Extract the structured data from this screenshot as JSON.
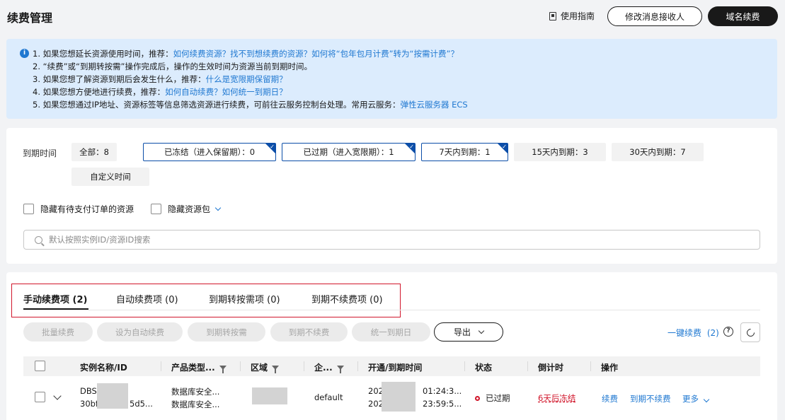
{
  "header": {
    "title": "续费管理",
    "guide": "使用指南",
    "modify_recipient": "修改消息接收人",
    "domain_renew": "域名续费"
  },
  "notice": {
    "icon": "info-icon",
    "lines": [
      {
        "text": "1. 如果您想延长资源使用时间，推荐：",
        "link": "如何续费资源？找不到想续费的资源？如何将“包年包月计费”转为“按需计费”？"
      },
      {
        "text": "2. “续费”或“到期转按需”操作完成后，操作的生效时间为资源当前到期时间。",
        "link": ""
      },
      {
        "text": "3. 如果您想了解资源到期后会发生什么，推荐：",
        "link": "什么是宽限期保留期？"
      },
      {
        "text": "4. 如果您想方便地进行续费，推荐：",
        "link": "如何自动续费？如何统一到期日？"
      },
      {
        "text": "5. 如果您想通过IP地址、资源标签等信息筛选资源进行续费，可前往云服务控制台处理。常用云服务：",
        "link": "弹性云服务器 ECS"
      }
    ]
  },
  "filter": {
    "label": "到期时间",
    "chips": [
      {
        "label": "全部：8",
        "selected": false
      },
      {
        "label": "已冻结（进入保留期）：0",
        "selected": true
      },
      {
        "label": "已过期（进入宽限期）：1",
        "selected": true
      },
      {
        "label": "7天内到期：1",
        "selected": true
      },
      {
        "label": "15天内到期：3",
        "selected": false
      },
      {
        "label": "30天内到期：7",
        "selected": false
      },
      {
        "label": "自定义时间",
        "selected": false
      }
    ],
    "hide_pending_orders": "隐藏有待支付订单的资源",
    "hide_packages": "隐藏资源包",
    "search_placeholder": "默认按照实例ID/资源ID搜索"
  },
  "tabs": [
    {
      "label": "手动续费项 (2)",
      "active": true
    },
    {
      "label": "自动续费项 (0)",
      "active": false
    },
    {
      "label": "到期转按需项 (0)",
      "active": false
    },
    {
      "label": "到期不续费项 (0)",
      "active": false
    }
  ],
  "actions": {
    "batch_renew": "批量续费",
    "set_auto": "设为自动续费",
    "to_ondemand": "到期转按需",
    "no_renew": "到期不续费",
    "unify_date": "统一到期日",
    "export": "导出",
    "one_click_renew": "一键续费",
    "one_click_count": "(2)"
  },
  "table": {
    "columns": [
      "实例名称/ID",
      "产品类型...",
      "区域",
      "企...",
      "开通/到期时间",
      "状态",
      "倒计时",
      "操作"
    ],
    "rows": [
      {
        "name": "DBS",
        "id_start": "30bf",
        "id_end": "5d5...",
        "product_1": "数据库安全...",
        "product_2": "数据库安全...",
        "enterprise": "default",
        "time_start_prefix": "202",
        "time_start_suffix": "01:24:3...",
        "time_end_prefix": "202",
        "time_end_suffix": "23:59:5...",
        "status": "已过期",
        "countdown": "6天后冻结",
        "op_renew": "续费",
        "op_no_renew": "到期不续费",
        "op_more": "更多"
      }
    ]
  },
  "colors": {
    "link": "#1f78d1",
    "notice_bg": "#dcecfd",
    "selected_border": "#0c4ea8",
    "danger": "#d1162b",
    "dark": "#191919"
  }
}
